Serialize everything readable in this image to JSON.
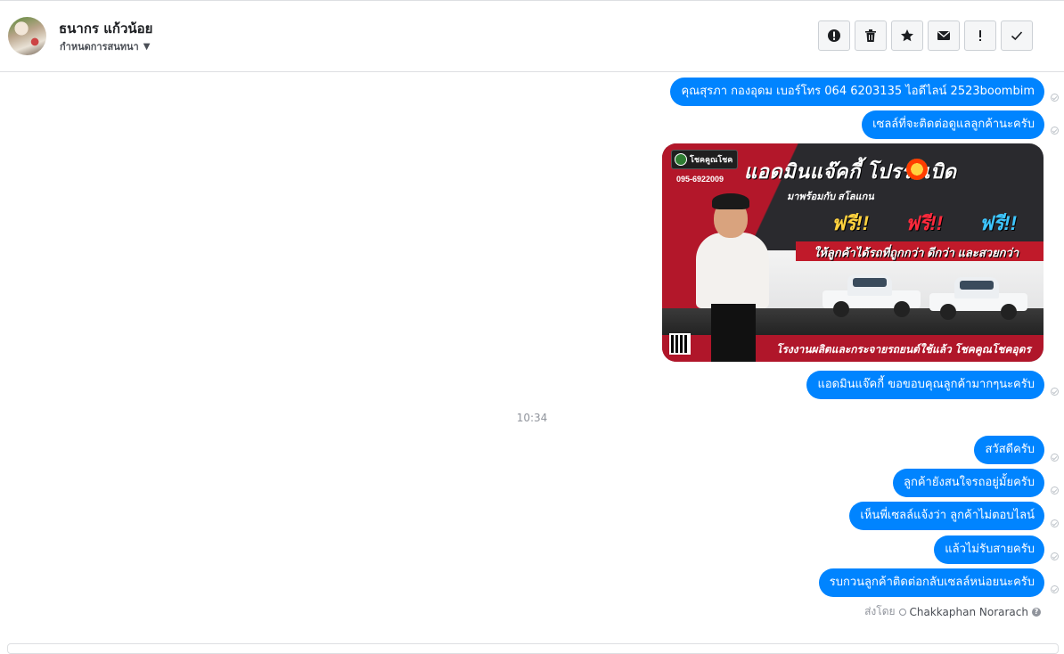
{
  "header": {
    "contact_name": "ธนากร แก้วน้อย",
    "subtitle": "กำหนดการสนทนา",
    "toolbar": [
      {
        "name": "report-icon",
        "label": "Report"
      },
      {
        "name": "trash-icon",
        "label": "Delete"
      },
      {
        "name": "star-icon",
        "label": "Star"
      },
      {
        "name": "envelope-icon",
        "label": "Mark unread"
      },
      {
        "name": "important-icon",
        "label": "Important",
        "text": "!"
      },
      {
        "name": "check-icon",
        "label": "Done"
      }
    ]
  },
  "messages": [
    {
      "text": "คุณสุรภา กองอุดม  เบอร์โทร 064 6203135         ไอดีไลน์ 2523boombim"
    },
    {
      "text": "เซลล์ที่จะติดต่อดูแลลูกค้านะครับ"
    },
    {
      "text": "แอดมินแจ๊คกี้ ขอขอบคุณลูกค้ามากๆนะครับ"
    },
    {
      "text": "สวัสดีครับ"
    },
    {
      "text": "ลูกค้ายังสนใจรถอยู่มั้ยครับ"
    },
    {
      "text": "เห็นพี่เซลล์แจ้งว่า ลูกค้าไม่ตอบไลน์"
    },
    {
      "text": "แล้วไม่รับสายครับ"
    },
    {
      "text": "รบกวนลูกค้าติดต่อกลับเซลล์หน่อยนะครับ"
    }
  ],
  "promo": {
    "brand": "โชคคูณโชค",
    "phone": "095-6922009",
    "headline": "แอดมินแจ๊คกี้  โปรระเบิด",
    "sub": "มาพร้อมกับ สโลแกน",
    "free": [
      "ฟรี!!",
      "ฟรี!!",
      "ฟรี!!"
    ],
    "free_colors": [
      "#ffd23f",
      "#ff2a3d",
      "#3ec6ff"
    ],
    "tagline": "ให้ลูกค้าได้รถที่ถูกกว่า ดีกว่า และสวยกว่า",
    "footer": "โรงงานผลิตและกระจายรถยนต์ใช้แล้ว โชคคูณโชคอุดร"
  },
  "timestamp": "10:34",
  "sent_by": {
    "prefix": "ส่งโดย",
    "name": "Chakkaphan Norarach",
    "help": "?"
  },
  "colors": {
    "bubble": "#0084ff",
    "border": "#dddfe2"
  }
}
